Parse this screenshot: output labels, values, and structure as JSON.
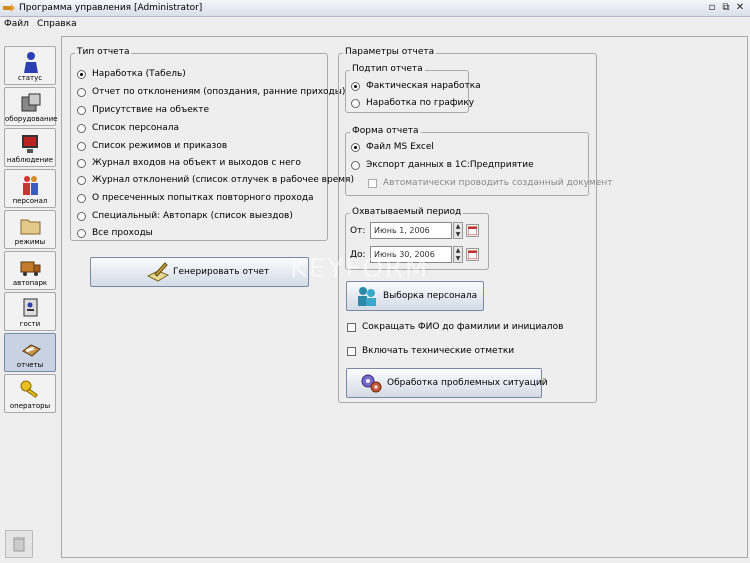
{
  "window": {
    "title": "Программа управления [Administrator]",
    "controls": [
      "minimize-icon",
      "restore-icon",
      "close-icon"
    ]
  },
  "menu": {
    "file": "Файл",
    "help": "Справка"
  },
  "sidebar": {
    "items": [
      {
        "label": "статус",
        "icon": "person-icon"
      },
      {
        "label": "оборудование",
        "icon": "equipment-icon"
      },
      {
        "label": "наблюдение",
        "icon": "monitor-icon"
      },
      {
        "label": "персонал",
        "icon": "people-icon"
      },
      {
        "label": "режимы",
        "icon": "folder-icon"
      },
      {
        "label": "автопарк",
        "icon": "truck-icon"
      },
      {
        "label": "гости",
        "icon": "badge-icon"
      },
      {
        "label": "отчеты",
        "icon": "reports-icon",
        "active": true
      },
      {
        "label": "операторы",
        "icon": "key-icon"
      }
    ]
  },
  "report_type": {
    "title": "Тип отчета",
    "selected": 0,
    "options": [
      "Наработка (Табель)",
      "Отчет по отклонениям (опоздания, ранние приходы)",
      "Присутствие на объекте",
      "Список персонала",
      "Список режимов и приказов",
      "Журнал входов на объект и выходов с него",
      "Журнал отклонений (список отлучек в рабочее время)",
      "О пресеченных попытках повторного прохода",
      "Специальный: Автопарк (список выездов)",
      "Все проходы"
    ]
  },
  "generate_button": "Генерировать отчет",
  "report_params": {
    "title": "Параметры отчета",
    "subtype": {
      "title": "Подтип отчета",
      "options": [
        "Фактическая наработка",
        "Наработка по графику"
      ],
      "selected": 0
    },
    "form": {
      "title": "Форма отчета",
      "options": [
        "Файл MS Excel",
        "Экспорт данных в 1С:Предприятие"
      ],
      "selected": 0,
      "auto_run_label": "Автоматически проводить созданный документ"
    },
    "period": {
      "title": "Охватываемый период",
      "from_label": "От:",
      "from_value": "Июнь 1, 2006",
      "to_label": "До:",
      "to_value": "Июнь 30, 2006"
    },
    "select_staff_button": "Выборка персонала",
    "abbreviate_label": "Сокращать ФИО до фамилии и инициалов",
    "tech_marks_label": "Включать технические отметки",
    "problems_button": "Обработка проблемных ситуаций"
  },
  "watermark": "KEYFORM"
}
